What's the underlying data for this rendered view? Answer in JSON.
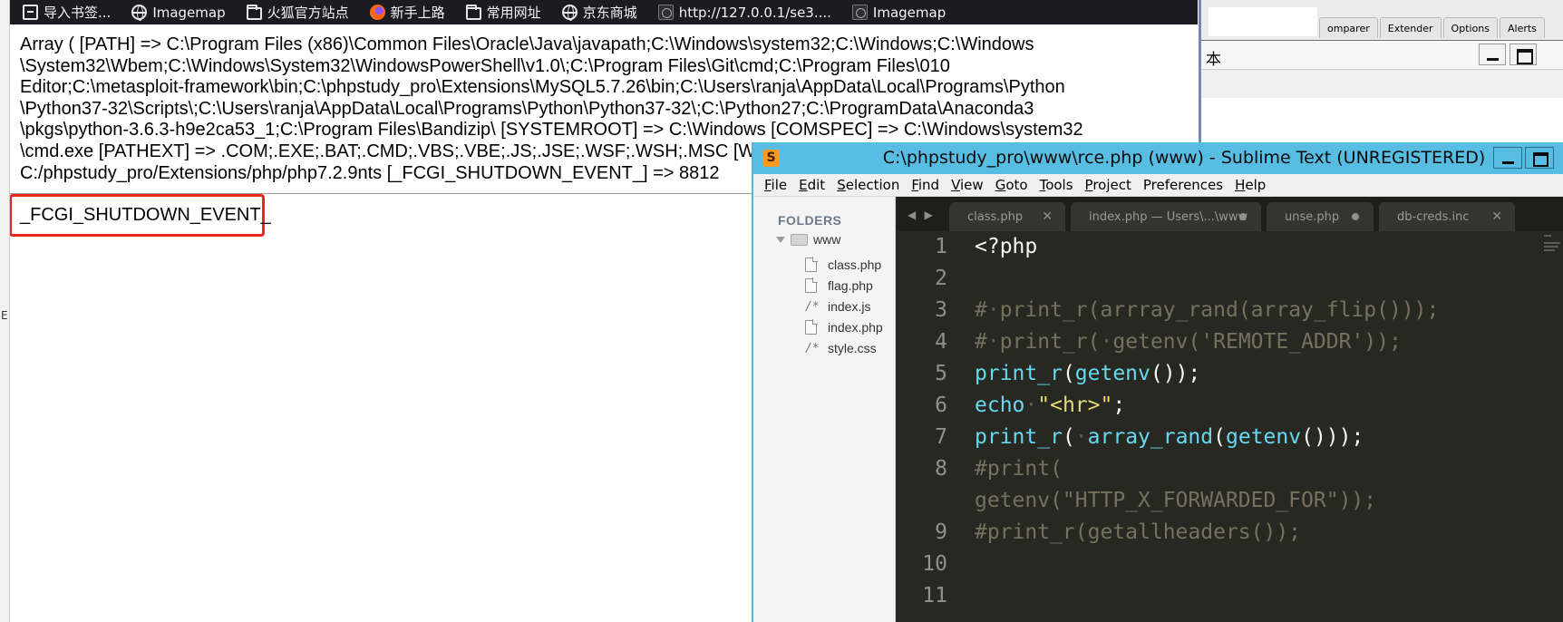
{
  "browser": {
    "bookmarks": [
      {
        "label": "导入书签...",
        "icon": "import-icon"
      },
      {
        "label": "Imagemap",
        "icon": "globe-icon"
      },
      {
        "label": "火狐官方站点",
        "icon": "folder-icon"
      },
      {
        "label": "新手上路",
        "icon": "firefox-icon"
      },
      {
        "label": "常用网址",
        "icon": "folder-icon"
      },
      {
        "label": "京东商城",
        "icon": "globe-icon"
      },
      {
        "label": "http://127.0.0.1/se3....",
        "icon": "page-icon"
      },
      {
        "label": "Imagemap",
        "icon": "page-icon"
      }
    ],
    "array_lines": [
      "Array ( [PATH] => C:\\Program Files (x86)\\Common Files\\Oracle\\Java\\javapath;C:\\Windows\\system32;C:\\Windows;C:\\Windows",
      "\\System32\\Wbem;C:\\Windows\\System32\\WindowsPowerShell\\v1.0\\;C:\\Program Files\\Git\\cmd;C:\\Program Files\\010",
      "Editor;C:\\metasploit-framework\\bin;C:\\phpstudy_pro\\Extensions\\MySQL5.7.26\\bin;C:\\Users\\ranja\\AppData\\Local\\Programs\\Python",
      "\\Python37-32\\Scripts\\;C:\\Users\\ranja\\AppData\\Local\\Programs\\Python\\Python37-32\\;C:\\Python27;C:\\ProgramData\\Anaconda3",
      "\\pkgs\\python-3.6.3-h9e2ca53_1;C:\\Program Files\\Bandizip\\ [SYSTEMROOT] => C:\\Windows [COMSPEC] => C:\\Windows\\system32",
      "\\cmd.exe [PATHEXT] => .COM;.EXE;.BAT;.CMD;.VBS;.VBE;.JS;.JSE;.WSF;.WSH;.MSC [WI",
      "C:/phpstudy_pro/Extensions/php/php7.2.9nts [_FCGI_SHUTDOWN_EVENT_] => 8812"
    ],
    "random_key": "_FCGI_SHUTDOWN_EVENT_",
    "left_strip_glyph": "E"
  },
  "burp": {
    "tabs": [
      "omparer",
      "Extender",
      "Options",
      "Alerts"
    ],
    "bar_text": "本"
  },
  "sublime": {
    "title": "C:\\phpstudy_pro\\www\\rce.php (www) - Sublime Text (UNREGISTERED)",
    "logo": "S",
    "menu": [
      {
        "u": "F",
        "rest": "ile"
      },
      {
        "u": "E",
        "rest": "dit"
      },
      {
        "u": "S",
        "rest": "election"
      },
      {
        "u": "F",
        "rest": "ind"
      },
      {
        "u": "V",
        "rest": "iew"
      },
      {
        "u": "G",
        "rest": "oto"
      },
      {
        "u": "T",
        "rest": "ools"
      },
      {
        "u": "P",
        "rest": "roject"
      },
      {
        "u": "",
        "rest": "Preferences"
      },
      {
        "u": "H",
        "rest": "elp"
      }
    ],
    "sidebar": {
      "header": "FOLDERS",
      "folder": "www",
      "files": [
        {
          "name": "class.php",
          "type": "file"
        },
        {
          "name": "flag.php",
          "type": "file"
        },
        {
          "name": "index.js",
          "type": "comment"
        },
        {
          "name": "index.php",
          "type": "file"
        },
        {
          "name": "style.css",
          "type": "comment"
        }
      ]
    },
    "tab_arrows": "◀ ▶",
    "tabs": [
      {
        "label": "class.php",
        "state": "close"
      },
      {
        "label": "index.php — Users\\...\\www",
        "state": "dirty"
      },
      {
        "label": "unse.php",
        "state": "dirty"
      },
      {
        "label": "db-creds.inc",
        "state": "close"
      }
    ],
    "line_numbers": [
      "1",
      "2",
      "3",
      "4",
      "5",
      "6",
      "7",
      "8",
      "9",
      "10",
      "11"
    ],
    "code": {
      "l1": "<?php",
      "l3a": "#",
      "l3b": "·",
      "l3c": "print_r(arrray_rand(array_flip()));",
      "l4a": "#",
      "l4b": "·",
      "l4c": "print_r(",
      "l4d": "·",
      "l4e": "getenv('REMOTE_ADDR'));",
      "l5a": "print_r",
      "l5b": "(",
      "l5c": "getenv",
      "l5d": "());",
      "l6a": "echo",
      "l6b": "·",
      "l6c": "\"<hr>\"",
      "l6d": ";",
      "l7a": "print_r",
      "l7b": "(",
      "l7c": "·",
      "l7d": "array_rand",
      "l7e": "(",
      "l7f": "getenv",
      "l7g": "()));",
      "l8a": "#print(",
      "l8b": "getenv(\"HTTP_X_FORWARDED_FOR\"));",
      "l9": "#print_r(getallheaders());"
    }
  }
}
